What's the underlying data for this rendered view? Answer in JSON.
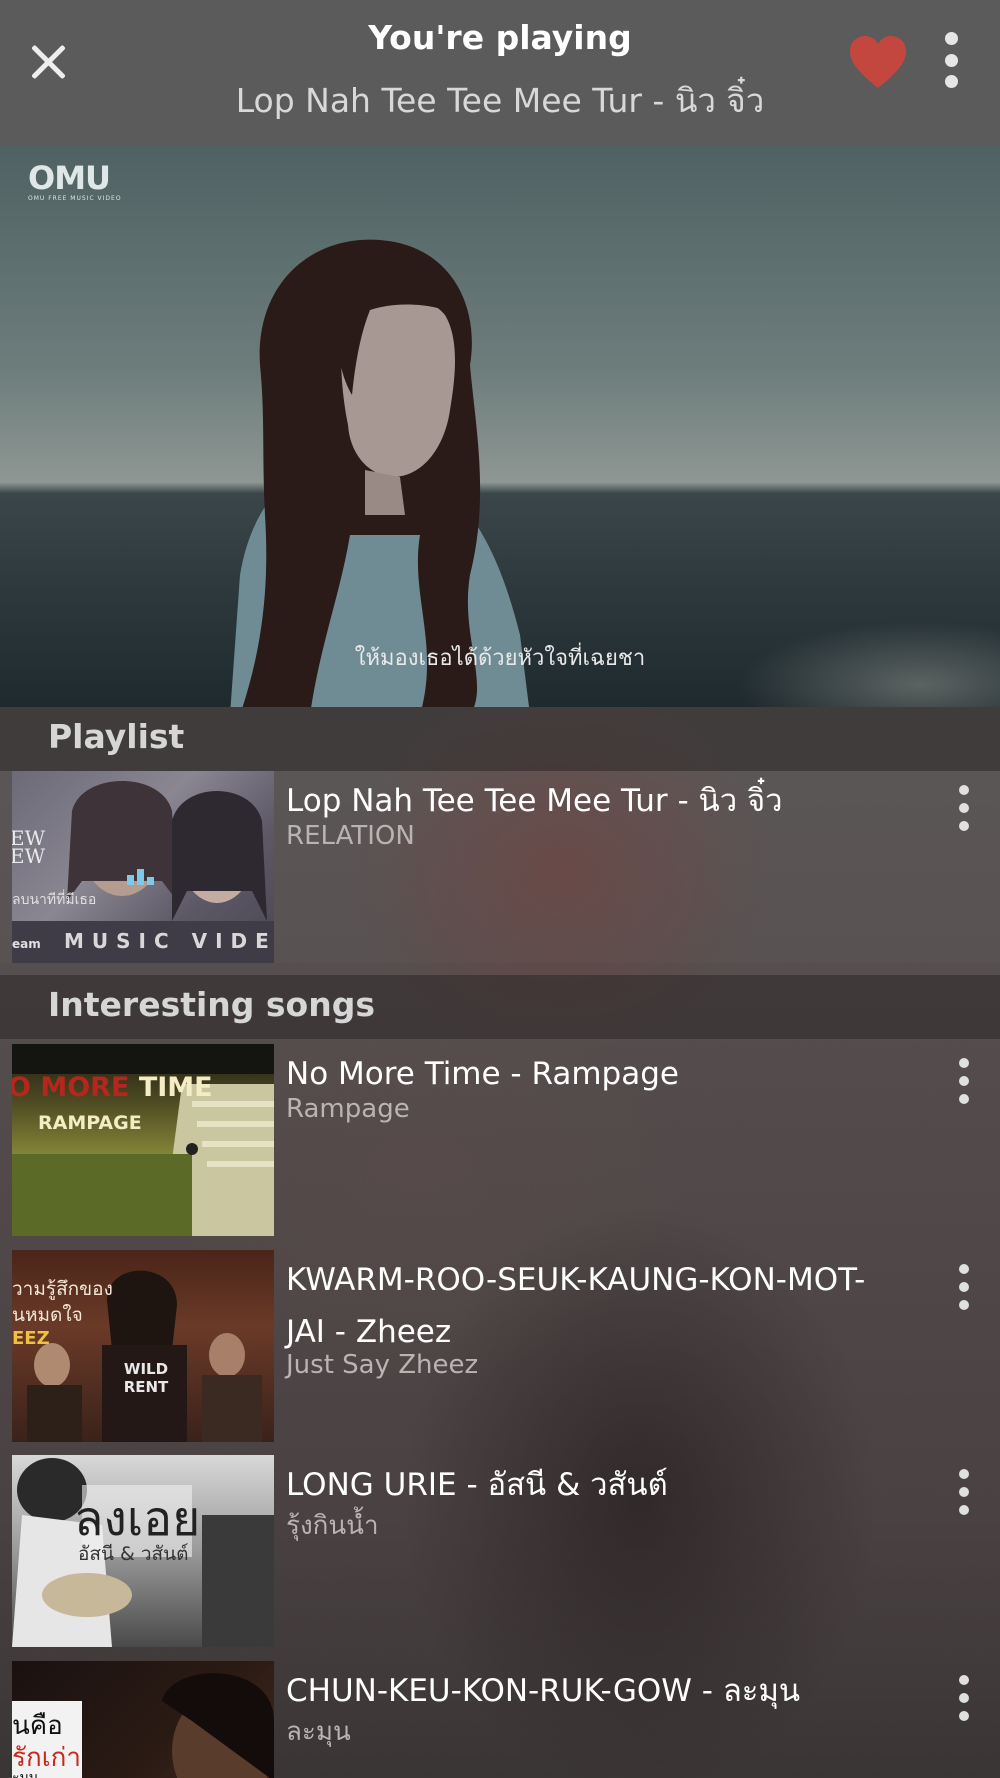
{
  "header": {
    "title": "You're playing",
    "subtitle": "Lop Nah Tee Tee Mee Tur - นิว จิ๋ว"
  },
  "video": {
    "logo": "OMU",
    "logo_small": "OMU FREE MUSIC VIDEO",
    "caption": "ให้มองเธอได้ด้วยหัวใจที่เฉยชา"
  },
  "playlist": {
    "label": "Playlist",
    "items": [
      {
        "title": "Lop Nah Tee Tee Mee Tur - นิว จิ๋ว",
        "artist": "RELATION",
        "thumb_text": "MUSIC VIDE",
        "thumb_side": "EW",
        "thumb_side2": "EW",
        "thumb_small": "ลบนาทีที่มีเธอ",
        "thumb_corner": "eam"
      }
    ]
  },
  "interesting": {
    "label": "Interesting songs",
    "items": [
      {
        "title": "No More Time - Rampage",
        "artist": "Rampage",
        "thumb_line1_a": "O MORE",
        "thumb_line1_b": " TIME",
        "thumb_line2": "RAMPAGE"
      },
      {
        "title": "KWARM-ROO-SEUK-KAUNG-KON-MOT-JAI - Zheez",
        "artist": "Just Say Zheez",
        "thumb_line1": "วามรู้สึกของ",
        "thumb_line2": "นหมดใจ",
        "thumb_line3": "EEZ",
        "thumb_shirt": "WILD RENT"
      },
      {
        "title": "LONG URIE - อัสนี & วสันต์",
        "artist": "รุ้งกินน้ำ",
        "thumb_line1": "ลงเอย",
        "thumb_line2": "อัสนี & วสันต์"
      },
      {
        "title": "CHUN-KEU-KON-RUK-GOW - ละมุน",
        "artist": "ละมุน",
        "thumb_line1": "นคือ",
        "thumb_line2": "รักเก่า",
        "thumb_line3": "ะมุน"
      }
    ]
  },
  "colors": {
    "heart": "#c4473f",
    "now_playing_bars": "#7fc9e8"
  }
}
